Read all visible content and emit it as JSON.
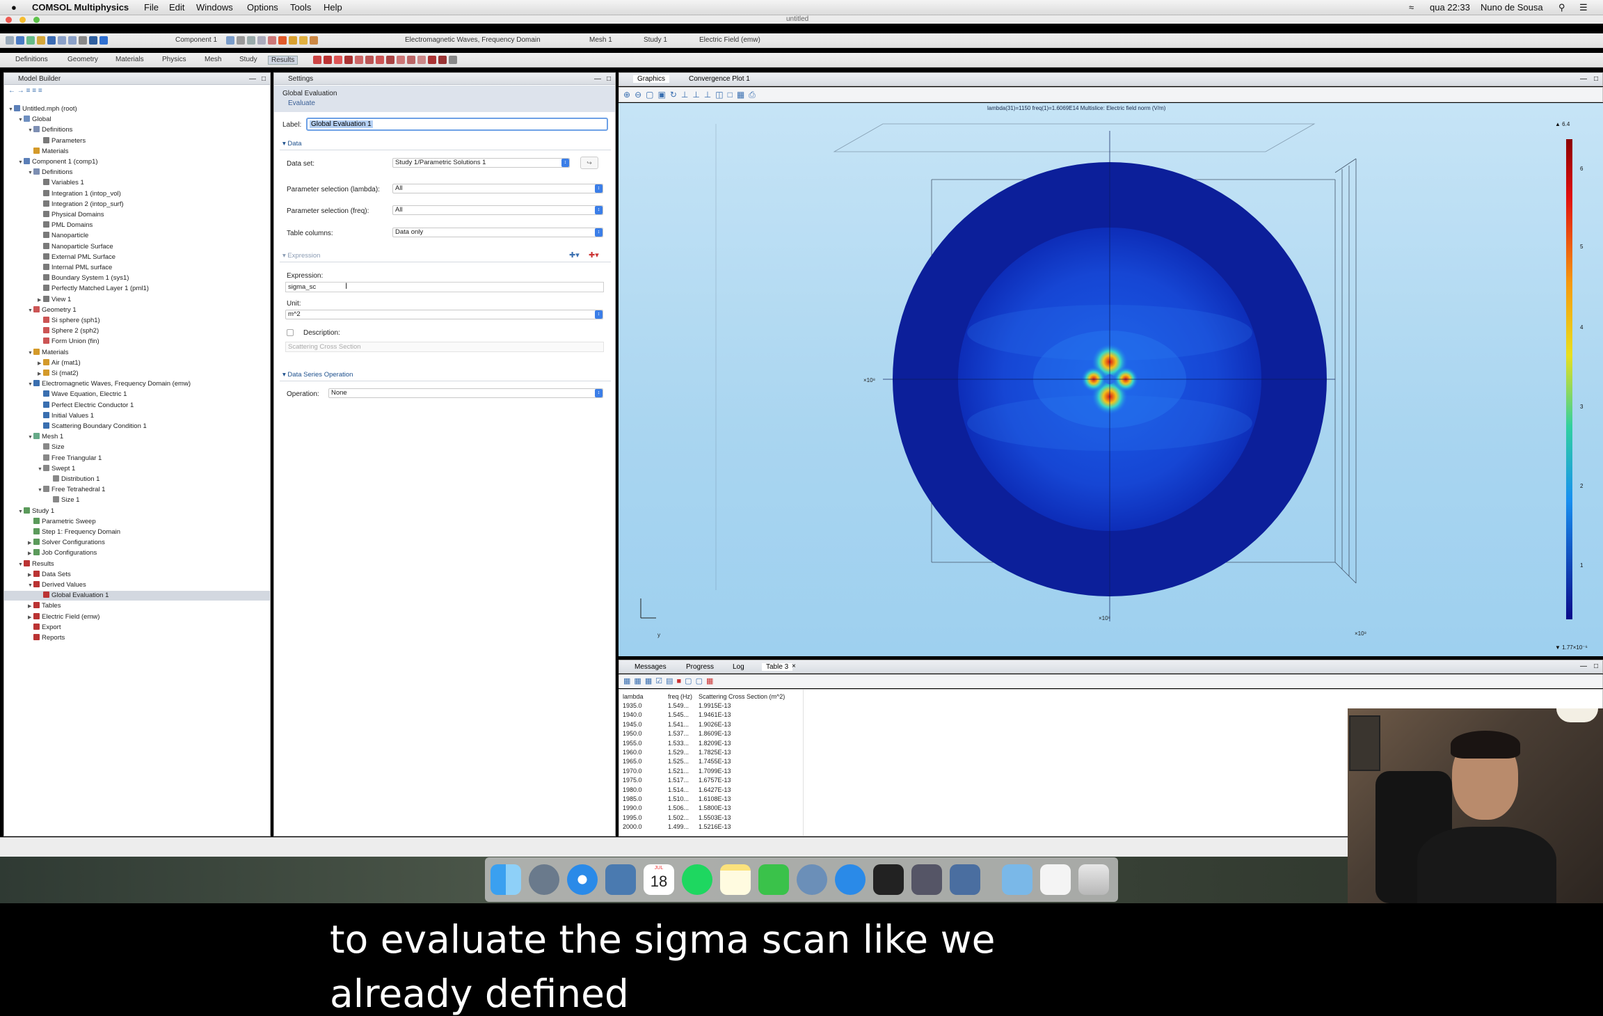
{
  "menubar": {
    "app_name": "COMSOL Multiphysics",
    "items": [
      "File",
      "Edit",
      "Windows",
      "Options",
      "Tools",
      "Help"
    ],
    "window_title": "untitled",
    "clock": "qua 22:33",
    "user": "Nuno de Sousa"
  },
  "toolbar1": {
    "component": "Component 1",
    "physics": "Electromagnetic Waves, Frequency Domain",
    "mesh": "Mesh 1",
    "study": "Study 1",
    "plot": "Electric Field (emw)"
  },
  "toolbar2": {
    "tabs": [
      "Definitions",
      "Geometry",
      "Materials",
      "Physics",
      "Mesh",
      "Study",
      "Results"
    ]
  },
  "model_builder": {
    "title": "Model Builder",
    "tree": [
      {
        "label": "Untitled.mph (root)",
        "level": 0,
        "exp": "v",
        "color": "#5b7fb8"
      },
      {
        "label": "Global",
        "level": 1,
        "exp": "v",
        "color": "#6e8fc0"
      },
      {
        "label": "Definitions",
        "level": 2,
        "exp": "v",
        "color": "#7d8fb3"
      },
      {
        "label": "Parameters",
        "level": 3,
        "exp": "",
        "color": "#7a7a7a"
      },
      {
        "label": "Materials",
        "level": 2,
        "exp": "",
        "color": "#d49a2a"
      },
      {
        "label": "Component 1 (comp1)",
        "level": 1,
        "exp": "v",
        "color": "#5b7fb8"
      },
      {
        "label": "Definitions",
        "level": 2,
        "exp": "v",
        "color": "#7d8fb3"
      },
      {
        "label": "Variables 1",
        "level": 3,
        "exp": "",
        "color": "#7a7a7a"
      },
      {
        "label": "Integration 1 (intop_vol)",
        "level": 3,
        "exp": "",
        "color": "#7a7a7a"
      },
      {
        "label": "Integration 2 (intop_surf)",
        "level": 3,
        "exp": "",
        "color": "#7a7a7a"
      },
      {
        "label": "Physical Domains",
        "level": 3,
        "exp": "",
        "color": "#7a7a7a"
      },
      {
        "label": "PML Domains",
        "level": 3,
        "exp": "",
        "color": "#7a7a7a"
      },
      {
        "label": "Nanoparticle",
        "level": 3,
        "exp": "",
        "color": "#7a7a7a"
      },
      {
        "label": "Nanoparticle Surface",
        "level": 3,
        "exp": "",
        "color": "#7a7a7a"
      },
      {
        "label": "External PML Surface",
        "level": 3,
        "exp": "",
        "color": "#7a7a7a"
      },
      {
        "label": "Internal PML surface",
        "level": 3,
        "exp": "",
        "color": "#7a7a7a"
      },
      {
        "label": "Boundary System 1 (sys1)",
        "level": 3,
        "exp": "",
        "color": "#7a7a7a"
      },
      {
        "label": "Perfectly Matched Layer 1 (pml1)",
        "level": 3,
        "exp": "",
        "color": "#7a7a7a"
      },
      {
        "label": "View 1",
        "level": 3,
        "exp": ">",
        "color": "#7a7a7a"
      },
      {
        "label": "Geometry 1",
        "level": 2,
        "exp": "v",
        "color": "#c55"
      },
      {
        "label": "Si sphere (sph1)",
        "level": 3,
        "exp": "",
        "color": "#c55"
      },
      {
        "label": "Sphere 2 (sph2)",
        "level": 3,
        "exp": "",
        "color": "#c55"
      },
      {
        "label": "Form Union (fin)",
        "level": 3,
        "exp": "",
        "color": "#c55"
      },
      {
        "label": "Materials",
        "level": 2,
        "exp": "v",
        "color": "#d49a2a"
      },
      {
        "label": "Air (mat1)",
        "level": 3,
        "exp": ">",
        "color": "#d49a2a"
      },
      {
        "label": "Si (mat2)",
        "level": 3,
        "exp": ">",
        "color": "#d49a2a"
      },
      {
        "label": "Electromagnetic Waves, Frequency Domain (emw)",
        "level": 2,
        "exp": "v",
        "color": "#3a6fb0"
      },
      {
        "label": "Wave Equation, Electric 1",
        "level": 3,
        "exp": "",
        "color": "#3a6fb0"
      },
      {
        "label": "Perfect Electric Conductor 1",
        "level": 3,
        "exp": "",
        "color": "#3a6fb0"
      },
      {
        "label": "Initial Values 1",
        "level": 3,
        "exp": "",
        "color": "#3a6fb0"
      },
      {
        "label": "Scattering Boundary Condition 1",
        "level": 3,
        "exp": "",
        "color": "#3a6fb0"
      },
      {
        "label": "Mesh 1",
        "level": 2,
        "exp": "v",
        "color": "#6a8"
      },
      {
        "label": "Size",
        "level": 3,
        "exp": "",
        "color": "#888"
      },
      {
        "label": "Free Triangular 1",
        "level": 3,
        "exp": "",
        "color": "#888"
      },
      {
        "label": "Swept 1",
        "level": 3,
        "exp": "v",
        "color": "#888"
      },
      {
        "label": "Distribution 1",
        "level": 4,
        "exp": "",
        "color": "#888"
      },
      {
        "label": "Free Tetrahedral 1",
        "level": 3,
        "exp": "v",
        "color": "#888"
      },
      {
        "label": "Size 1",
        "level": 4,
        "exp": "",
        "color": "#888"
      },
      {
        "label": "Study 1",
        "level": 1,
        "exp": "v",
        "color": "#5b9a5b"
      },
      {
        "label": "Parametric Sweep",
        "level": 2,
        "exp": "",
        "color": "#5b9a5b"
      },
      {
        "label": "Step 1: Frequency Domain",
        "level": 2,
        "exp": "",
        "color": "#5b9a5b"
      },
      {
        "label": "Solver Configurations",
        "level": 2,
        "exp": ">",
        "color": "#5b9a5b"
      },
      {
        "label": "Job Configurations",
        "level": 2,
        "exp": ">",
        "color": "#5b9a5b"
      },
      {
        "label": "Results",
        "level": 1,
        "exp": "v",
        "color": "#b33"
      },
      {
        "label": "Data Sets",
        "level": 2,
        "exp": ">",
        "color": "#b33"
      },
      {
        "label": "Derived Values",
        "level": 2,
        "exp": "v",
        "color": "#b33"
      },
      {
        "label": "Global Evaluation 1",
        "level": 3,
        "exp": "",
        "color": "#b33",
        "selected": true
      },
      {
        "label": "Tables",
        "level": 2,
        "exp": ">",
        "color": "#b33"
      },
      {
        "label": "Electric Field (emw)",
        "level": 2,
        "exp": ">",
        "color": "#b33"
      },
      {
        "label": "Export",
        "level": 2,
        "exp": "",
        "color": "#b33"
      },
      {
        "label": "Reports",
        "level": 2,
        "exp": "",
        "color": "#b33"
      }
    ]
  },
  "settings": {
    "title": "Settings",
    "subtitle": "Global Evaluation",
    "evaluate": "Evaluate",
    "label_caption": "Label:",
    "label_value": "Global Evaluation 1",
    "data_section": "Data",
    "dataset_caption": "Data set:",
    "dataset_value": "Study 1/Parametric Solutions 1",
    "param_lambda_caption": "Parameter selection (lambda):",
    "param_lambda_value": "All",
    "param_freq_caption": "Parameter selection (freq):",
    "param_freq_value": "All",
    "table_columns_caption": "Table columns:",
    "table_columns_value": "Data only",
    "expression_section": "Expression",
    "expression_caption": "Expression:",
    "expression_value": "sigma_sc",
    "unit_caption": "Unit:",
    "unit_value": "m^2",
    "description_caption": "Description:",
    "description_placeholder": "Scattering Cross Section",
    "dso_section": "Data Series Operation",
    "operation_caption": "Operation:",
    "operation_value": "None"
  },
  "graphics": {
    "tabs": [
      "Graphics",
      "Convergence Plot 1"
    ],
    "plot_title": "lambda(31)=1150 freq(1)=1.6069E14   Multislice: Electric field norm (V/m)",
    "colorbar_max": "▲ 6.4",
    "colorbar_min": "▼ 1.77×10⁻⁶",
    "colorbar_ticks": [
      "6",
      "5",
      "4",
      "3",
      "2",
      "1"
    ],
    "axis_scale": "×10⁸",
    "axis_y": "y"
  },
  "table_panel": {
    "tabs": [
      "Messages",
      "Progress",
      "Log",
      "Table 3"
    ],
    "headers": [
      "lambda",
      "freq (Hz)",
      "Scattering Cross Section (m^2)"
    ],
    "rows": [
      [
        "1935.0",
        "1.549...",
        "1.9915E-13"
      ],
      [
        "1940.0",
        "1.545...",
        "1.9461E-13"
      ],
      [
        "1945.0",
        "1.541...",
        "1.9026E-13"
      ],
      [
        "1950.0",
        "1.537...",
        "1.8609E-13"
      ],
      [
        "1955.0",
        "1.533...",
        "1.8209E-13"
      ],
      [
        "1960.0",
        "1.529...",
        "1.7825E-13"
      ],
      [
        "1965.0",
        "1.525...",
        "1.7455E-13"
      ],
      [
        "1970.0",
        "1.521...",
        "1.7099E-13"
      ],
      [
        "1975.0",
        "1.517...",
        "1.6757E-13"
      ],
      [
        "1980.0",
        "1.514...",
        "1.6427E-13"
      ],
      [
        "1985.0",
        "1.510...",
        "1.6108E-13"
      ],
      [
        "1990.0",
        "1.506...",
        "1.5800E-13"
      ],
      [
        "1995.0",
        "1.502...",
        "1.5503E-13"
      ],
      [
        "2000.0",
        "1.499...",
        "1.5216E-13"
      ]
    ]
  },
  "dock": {
    "calendar_day": "18",
    "calendar_month": "JUL"
  },
  "subtitles": {
    "line1": "to evaluate the sigma scan like we",
    "line2": "already defined"
  },
  "colors": {
    "accent": "#3b7ee8",
    "field_low": "#0a1a8c",
    "field_high": "#d01818"
  }
}
